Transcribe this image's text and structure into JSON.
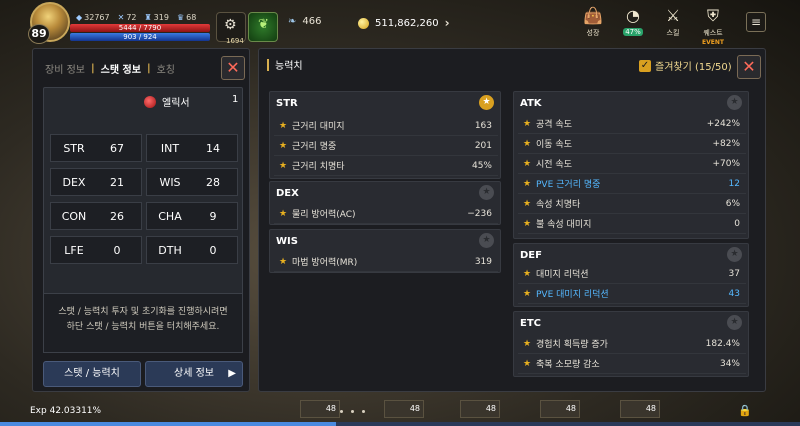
{
  "hud": {
    "level": "89",
    "combat_power": "32767",
    "stat_a": "72",
    "stat_b": "319",
    "stat_c": "68",
    "hp": "5444 / 7790",
    "mp": "903 / 924",
    "gear_count": "1694",
    "wings": "466",
    "gold": "511,862,260",
    "icons": [
      {
        "label": "성장",
        "icon": "bag-icon"
      },
      {
        "label": "",
        "icon": "progress-icon",
        "badge": "47%"
      },
      {
        "label": "스킬",
        "icon": "skill-icon"
      },
      {
        "label": "퀘스트",
        "icon": "quest-icon",
        "event": "EVENT"
      }
    ],
    "exp": "Exp  42.03311%",
    "exp_fraction": 0.42,
    "slot_values": [
      "48",
      "48",
      "48",
      "48",
      "48"
    ]
  },
  "left": {
    "tabs": [
      "장비 정보",
      "스탯 정보",
      "호칭"
    ],
    "active_tab": "스탯 정보",
    "elixir_label": "엘릭서",
    "elixir_count": "1",
    "stats": [
      {
        "key": "STR",
        "value": "67"
      },
      {
        "key": "INT",
        "value": "14"
      },
      {
        "key": "DEX",
        "value": "21"
      },
      {
        "key": "WIS",
        "value": "28"
      },
      {
        "key": "CON",
        "value": "26"
      },
      {
        "key": "CHA",
        "value": "9"
      },
      {
        "key": "LFE",
        "value": "0"
      },
      {
        "key": "DTH",
        "value": "0"
      }
    ],
    "info_line1": "스탯 / 능력치 투자 및 초기화를 진행하시려면",
    "info_line2": "하단 스탯 / 능력치 버튼을 터치해주세요.",
    "btn_stat": "스탯 / 능력치",
    "btn_detail": "상세 정보"
  },
  "right": {
    "title": "능력치",
    "favorites": "즐겨찾기 (15/50)",
    "sections": {
      "str": {
        "name": "STR",
        "rows": [
          {
            "name": "근거리 대미지",
            "value": "163"
          },
          {
            "name": "근거리 명중",
            "value": "201"
          },
          {
            "name": "근거리 치명타",
            "value": "45%"
          }
        ]
      },
      "dex": {
        "name": "DEX",
        "rows": [
          {
            "name": "물리 방어력(AC)",
            "value": "−236"
          }
        ]
      },
      "wis": {
        "name": "WIS",
        "rows": [
          {
            "name": "마법 방어력(MR)",
            "value": "319"
          }
        ]
      },
      "atk": {
        "name": "ATK",
        "rows": [
          {
            "name": "공격 속도",
            "value": "+242%"
          },
          {
            "name": "이동 속도",
            "value": "+82%"
          },
          {
            "name": "시전 속도",
            "value": "+70%"
          },
          {
            "name": "PVE 근거리 명중",
            "value": "12"
          },
          {
            "name": "속성 치명타",
            "value": "6%"
          },
          {
            "name": "불 속성 대미지",
            "value": "0"
          }
        ]
      },
      "def": {
        "name": "DEF",
        "rows": [
          {
            "name": "대미지 리덕션",
            "value": "37"
          },
          {
            "name": "PVE 대미지 리덕션",
            "value": "43"
          }
        ]
      },
      "etc": {
        "name": "ETC",
        "rows": [
          {
            "name": "경험치 획득량 증가",
            "value": "182.4%"
          },
          {
            "name": "축복 소모량 감소",
            "value": "34%"
          }
        ]
      }
    }
  }
}
